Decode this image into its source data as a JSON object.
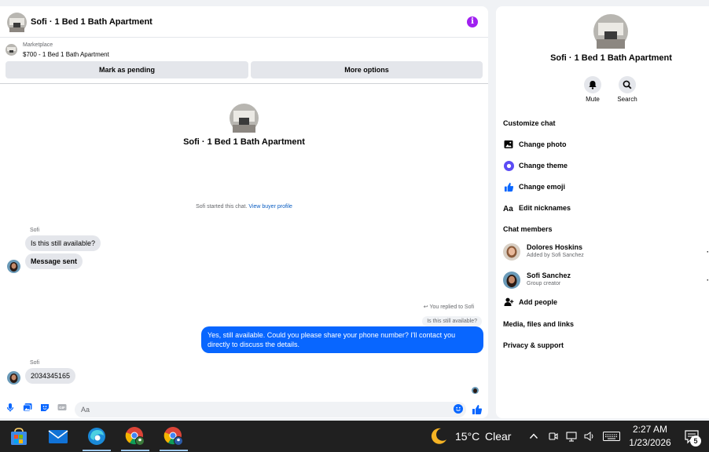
{
  "chat": {
    "title": "Sofi · 1 Bed 1 Bath Apartment",
    "marketplace_label": "Marketplace",
    "listing": "$700 - 1 Bed 1 Bath Apartment",
    "mark_pending_label": "Mark as pending",
    "more_options_label": "More options",
    "intro_name": "Sofi · 1 Bed 1 Bath Apartment",
    "system_text": "Sofi started this chat.",
    "system_link": "View buyer profile",
    "messages": [
      {
        "sender": "Sofi",
        "text": "Is this still available?"
      },
      {
        "text": "Message sent"
      },
      {
        "reply_note": "You replied to Sofi",
        "quoted": "Is this still available?",
        "text": "Yes, still available. Could you please share your phone number? I'll contact you directly to discuss the details."
      },
      {
        "sender": "Sofi",
        "text": "2034345165"
      }
    ],
    "composer_placeholder": "Aa"
  },
  "info": {
    "name": "Sofi · 1 Bed 1 Bath Apartment",
    "mute_label": "Mute",
    "search_label": "Search",
    "customize_header": "Customize chat",
    "customize_items": [
      "Change photo",
      "Change theme",
      "Change emoji",
      "Edit nicknames"
    ],
    "members_header": "Chat members",
    "members": [
      {
        "name": "Dolores Hoskins",
        "sub": "Added by Sofi Sanchez"
      },
      {
        "name": "Sofi Sanchez",
        "sub": "Group creator"
      }
    ],
    "add_people_label": "Add people",
    "media_label": "Media, files and links",
    "privacy_label": "Privacy & support"
  },
  "taskbar": {
    "temperature": "15°C",
    "condition": "Clear",
    "time": "2:27 AM",
    "date": "1/23/2026",
    "notification_count": "5"
  },
  "colors": {
    "accent": "#0866ff",
    "info_icon": "#a020f0",
    "theme_icon": "#5b4cf5"
  }
}
